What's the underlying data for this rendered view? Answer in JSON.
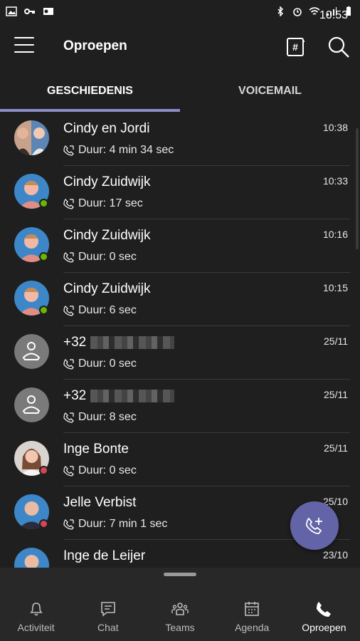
{
  "status_bar": {
    "time": "10:53"
  },
  "header": {
    "title": "Oproepen"
  },
  "tabs": [
    {
      "label": "GESCHIEDENIS"
    },
    {
      "label": "VOICEMAIL"
    }
  ],
  "calls": [
    {
      "name": "Cindy en Jordi",
      "duration": "Duur: 4 min 34 sec",
      "time": "10:38"
    },
    {
      "name": "Cindy Zuidwijk",
      "duration": "Duur: 17 sec",
      "time": "10:33"
    },
    {
      "name": "Cindy Zuidwijk",
      "duration": "Duur: 0 sec",
      "time": "10:16"
    },
    {
      "name": "Cindy Zuidwijk",
      "duration": "Duur: 6 sec",
      "time": "10:15"
    },
    {
      "name": "+32",
      "duration": "Duur: 0 sec",
      "time": "25/11"
    },
    {
      "name": "+32",
      "duration": "Duur: 8 sec",
      "time": "25/11"
    },
    {
      "name": "Inge Bonte",
      "duration": "Duur: 0 sec",
      "time": "25/11"
    },
    {
      "name": "Jelle Verbist",
      "duration": "Duur: 7 min 1 sec",
      "time": "25/10"
    },
    {
      "name": "Inge de Leijer",
      "duration": "",
      "time": "23/10"
    }
  ],
  "nav": [
    {
      "label": "Activiteit",
      "icon": "bell-icon"
    },
    {
      "label": "Chat",
      "icon": "chat-icon"
    },
    {
      "label": "Teams",
      "icon": "teams-icon"
    },
    {
      "label": "Agenda",
      "icon": "calendar-icon"
    },
    {
      "label": "Oproepen",
      "icon": "phone-icon"
    }
  ],
  "colors": {
    "accent": "#6264a7",
    "tab_indicator": "#8b8cc7",
    "presence_available": "#6bb700",
    "presence_busy": "#d74553"
  }
}
